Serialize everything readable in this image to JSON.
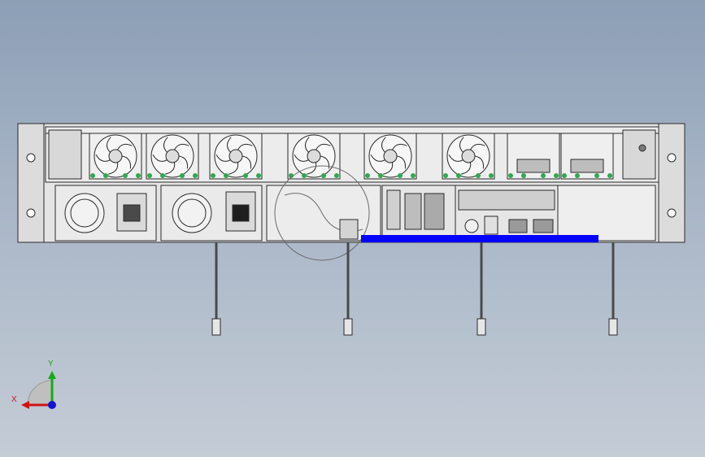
{
  "viewport": {
    "background_top": "#8c9fb6",
    "background_bottom": "#c4ccd6"
  },
  "model": {
    "name_icon": "server-chassis-2u-rear-view",
    "line_color": "#2a2a2a",
    "face_color": "#e9e9e9",
    "highlight_color": "#0000ff",
    "fan_mount_color": "#2fa84f",
    "fan_count": 6,
    "psu_count": 2
  },
  "triad": {
    "x_label": "X",
    "y_label": "Y",
    "x_color": "#d01414",
    "y_color": "#1aa81a",
    "z_color": "#1414d0"
  }
}
